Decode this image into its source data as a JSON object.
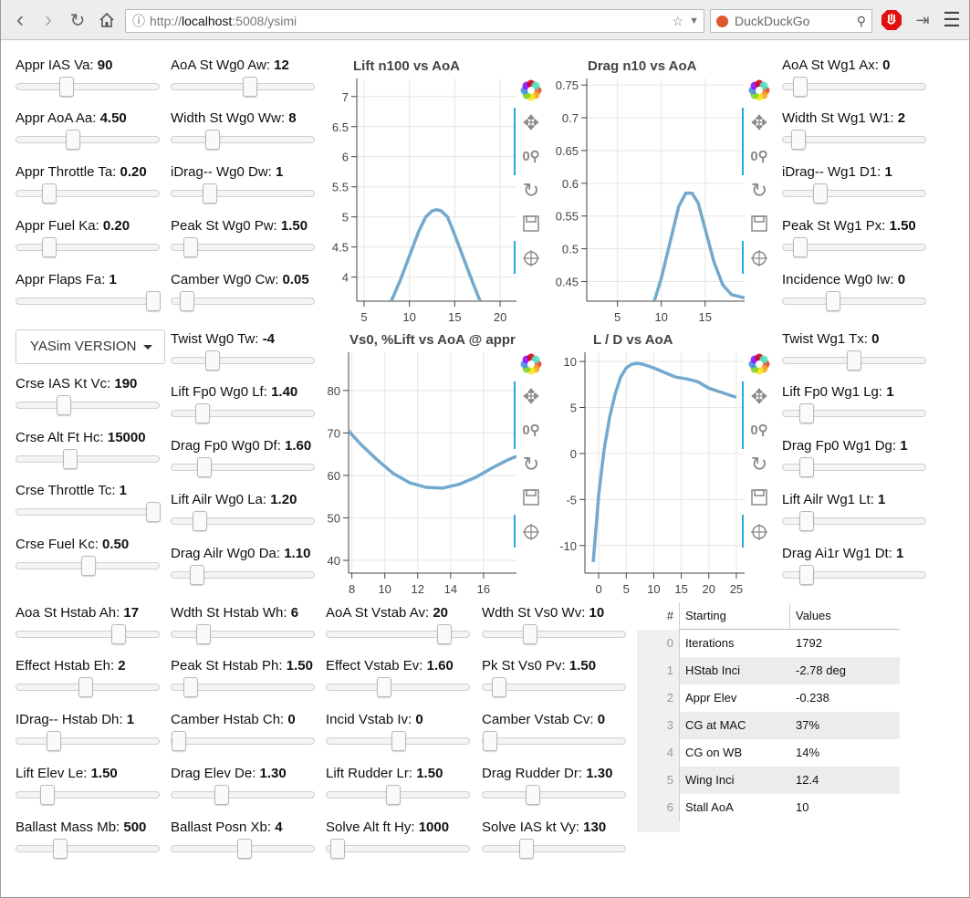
{
  "browser": {
    "url_scheme": "http://",
    "url_host": "localhost",
    "url_rest": ":5008/ysimi",
    "search_placeholder": "DuckDuckGo"
  },
  "sliders": [
    {
      "id": "appr-ias-va",
      "label": "Appr IAS Va:",
      "value": "90",
      "frac": 0.33
    },
    {
      "id": "appr-aoa-aa",
      "label": "Appr AoA Aa:",
      "value": "4.50",
      "frac": 0.38
    },
    {
      "id": "appr-throttle-ta",
      "label": "Appr Throttle Ta:",
      "value": "0.20",
      "frac": 0.2
    },
    {
      "id": "appr-fuel-ka",
      "label": "Appr Fuel Ka:",
      "value": "0.20",
      "frac": 0.2
    },
    {
      "id": "appr-flaps-fa",
      "label": "Appr Flaps Fa:",
      "value": "1",
      "frac": 1.0
    },
    {
      "id": "crse-ias-vc",
      "label": "Crse IAS Kt Vc:",
      "value": "190",
      "frac": 0.31
    },
    {
      "id": "crse-alt-hc",
      "label": "Crse Alt Ft Hc:",
      "value": "15000",
      "frac": 0.36
    },
    {
      "id": "crse-throttle-tc",
      "label": "Crse Throttle Tc:",
      "value": "1",
      "frac": 1.0
    },
    {
      "id": "crse-fuel-kc",
      "label": "Crse Fuel Kc:",
      "value": "0.50",
      "frac": 0.5
    },
    {
      "id": "aoa-st-wg0-aw",
      "label": "AoA St Wg0 Aw:",
      "value": "12",
      "frac": 0.55
    },
    {
      "id": "width-st-wg0-ww",
      "label": "Width St Wg0 Ww:",
      "value": "8",
      "frac": 0.26
    },
    {
      "id": "idrag-wg0-dw",
      "label": "iDrag-- Wg0 Dw:",
      "value": "1",
      "frac": 0.24
    },
    {
      "id": "peak-st-wg0-pw",
      "label": "Peak St Wg0 Pw:",
      "value": "1.50",
      "frac": 0.09
    },
    {
      "id": "camber-wg0-cw",
      "label": "Camber Wg0 Cw:",
      "value": "0.05",
      "frac": 0.06
    },
    {
      "id": "twist-wg0-tw",
      "label": "Twist Wg0 Tw:",
      "value": "-4",
      "frac": 0.26
    },
    {
      "id": "lift-fp0-wg0-lf",
      "label": "Lift Fp0 Wg0 Lf:",
      "value": "1.40",
      "frac": 0.18
    },
    {
      "id": "drag-fp0-wg0-df",
      "label": "Drag Fp0 Wg0 Df:",
      "value": "1.60",
      "frac": 0.2
    },
    {
      "id": "lift-ailr-wg0-la",
      "label": "Lift Ailr Wg0 La:",
      "value": "1.20",
      "frac": 0.16
    },
    {
      "id": "drag-ailr-wg0-da",
      "label": "Drag Ailr Wg0 Da:",
      "value": "1.10",
      "frac": 0.14
    },
    {
      "id": "aoa-st-wg1-ax",
      "label": "AoA St Wg1 Ax:",
      "value": "0",
      "frac": 0.08
    },
    {
      "id": "width-st-wg1-w1",
      "label": "Width St Wg1 W1:",
      "value": "2",
      "frac": 0.06
    },
    {
      "id": "idrag-wg1-d1",
      "label": "iDrag-- Wg1 D1:",
      "value": "1",
      "frac": 0.23
    },
    {
      "id": "peak-st-wg1-px",
      "label": "Peak St Wg1 Px:",
      "value": "1.50",
      "frac": 0.08
    },
    {
      "id": "incidence-wg0-iw",
      "label": "Incidence Wg0 Iw:",
      "value": "0",
      "frac": 0.33
    },
    {
      "id": "twist-wg1-tx",
      "label": "Twist Wg1 Tx:",
      "value": "0",
      "frac": 0.49
    },
    {
      "id": "lift-fp0-wg1-lg",
      "label": "Lift Fp0 Wg1 Lg:",
      "value": "1",
      "frac": 0.13
    },
    {
      "id": "drag-fp0-wg1-dg",
      "label": "Drag Fp0 Wg1 Dg:",
      "value": "1",
      "frac": 0.13
    },
    {
      "id": "lift-ailr-wg1-lt",
      "label": "Lift Ailr Wg1 Lt:",
      "value": "1",
      "frac": 0.13
    },
    {
      "id": "drag-ai1r-wg1-dt",
      "label": "Drag Ai1r Wg1 Dt:",
      "value": "1",
      "frac": 0.13
    },
    {
      "id": "aoa-st-hstab-ah",
      "label": "Aoa St Hstab Ah:",
      "value": "17",
      "frac": 0.73
    },
    {
      "id": "effect-hstab-eh",
      "label": "Effect Hstab Eh:",
      "value": "2",
      "frac": 0.48
    },
    {
      "id": "idrag-hstab-dh",
      "label": "IDrag-- Hstab Dh:",
      "value": "1",
      "frac": 0.23
    },
    {
      "id": "lift-elev-le",
      "label": "Lift Elev Le:",
      "value": "1.50",
      "frac": 0.18
    },
    {
      "id": "ballast-mass-mb",
      "label": "Ballast Mass Mb:",
      "value": "500",
      "frac": 0.28
    },
    {
      "id": "wdth-st-hstab-wh",
      "label": "Wdth St Hstab Wh:",
      "value": "6",
      "frac": 0.19
    },
    {
      "id": "peak-st-hstab-ph",
      "label": "Peak St Hstab Ph:",
      "value": "1.50",
      "frac": 0.09
    },
    {
      "id": "camber-hstab-ch",
      "label": "Camber Hstab Ch:",
      "value": "0",
      "frac": 0.0
    },
    {
      "id": "drag-elev-de",
      "label": "Drag Elev De:",
      "value": "1.30",
      "frac": 0.33
    },
    {
      "id": "ballast-posn-xb",
      "label": "Ballast Posn Xb:",
      "value": "4",
      "frac": 0.51
    },
    {
      "id": "aoa-st-vstab-av",
      "label": "AoA St Vstab Av:",
      "value": "20",
      "frac": 0.85
    },
    {
      "id": "effect-vstab-ev",
      "label": "Effect Vstab Ev:",
      "value": "1.60",
      "frac": 0.39
    },
    {
      "id": "incid-vstab-iv",
      "label": "Incid Vstab Iv:",
      "value": "0",
      "frac": 0.5
    },
    {
      "id": "lift-rudder-lr",
      "label": "Lift Rudder Lr:",
      "value": "1.50",
      "frac": 0.46
    },
    {
      "id": "solve-alt-hy",
      "label": "Solve Alt ft Hy:",
      "value": "1000",
      "frac": 0.03
    },
    {
      "id": "wdth-st-vs0-wv",
      "label": "Wdth St Vs0 Wv:",
      "value": "10",
      "frac": 0.31
    },
    {
      "id": "pk-st-vs0-pv",
      "label": "Pk St Vs0 Pv:",
      "value": "1.50",
      "frac": 0.07
    },
    {
      "id": "camber-vstab-cv",
      "label": "Camber Vstab Cv:",
      "value": "0",
      "frac": 0.0
    },
    {
      "id": "drag-rudder-dr",
      "label": "Drag Rudder Dr:",
      "value": "1.30",
      "frac": 0.33
    },
    {
      "id": "solve-ias-vy",
      "label": "Solve IAS kt Vy:",
      "value": "130",
      "frac": 0.28
    }
  ],
  "version_dropdown": {
    "label": "YASim VERSION"
  },
  "chart_data": [
    {
      "id": "lift",
      "type": "line",
      "title": "Lift n100 vs AoA",
      "xlim": [
        4.2,
        21.8
      ],
      "ylim": [
        3.6,
        7.3
      ],
      "xticks": [
        5,
        10,
        15,
        20
      ],
      "yticks": [
        4,
        4.5,
        5,
        5.5,
        6,
        6.5,
        7
      ],
      "grid": true,
      "series": [
        {
          "x": [
            8.0,
            9.0,
            10.0,
            11.0,
            11.8,
            12.5,
            13.0,
            13.5,
            14.2,
            15.0,
            16.0,
            17.0,
            17.8
          ],
          "y": [
            3.6,
            3.95,
            4.35,
            4.75,
            5.0,
            5.1,
            5.12,
            5.1,
            5.0,
            4.7,
            4.3,
            3.9,
            3.6
          ]
        }
      ]
    },
    {
      "id": "drag",
      "type": "line",
      "title": "Drag  n10 vs AoA",
      "xlim": [
        1.5,
        19.5
      ],
      "ylim": [
        0.42,
        0.76
      ],
      "xticks": [
        5,
        10,
        15
      ],
      "yticks": [
        0.45,
        0.5,
        0.55,
        0.6,
        0.65,
        0.7,
        0.75
      ],
      "grid": true,
      "series": [
        {
          "x": [
            9.2,
            10.0,
            11.0,
            12.0,
            12.8,
            13.5,
            14.2,
            15.0,
            16.0,
            17.0,
            18.0,
            19.5
          ],
          "y": [
            0.42,
            0.455,
            0.51,
            0.565,
            0.585,
            0.585,
            0.57,
            0.53,
            0.48,
            0.445,
            0.43,
            0.425
          ]
        }
      ]
    },
    {
      "id": "vs0",
      "type": "line",
      "title": "Vs0, %Lift vs AoA @ appr",
      "xlim": [
        7.8,
        18.0
      ],
      "ylim": [
        37,
        89
      ],
      "xticks": [
        8,
        10,
        12,
        14,
        16
      ],
      "yticks": [
        40,
        50,
        60,
        70,
        80
      ],
      "grid": true,
      "series": [
        {
          "x": [
            7.8,
            8.5,
            9.5,
            10.5,
            11.5,
            12.5,
            13.5,
            14.5,
            15.5,
            16.5,
            17.5,
            18.0
          ],
          "y": [
            70.5,
            67.5,
            63.8,
            60.5,
            58.3,
            57.2,
            57.0,
            57.9,
            59.5,
            61.7,
            63.7,
            64.5
          ]
        }
      ]
    },
    {
      "id": "ld",
      "type": "line",
      "title": "L / D   vs AoA",
      "xlim": [
        -2.5,
        26.5
      ],
      "ylim": [
        -13,
        11
      ],
      "xticks": [
        0,
        5,
        10,
        15,
        20,
        25
      ],
      "yticks": [
        -10,
        -5,
        0,
        5,
        10
      ],
      "grid": true,
      "series": [
        {
          "x": [
            -1,
            0,
            1,
            2,
            3,
            4,
            5,
            6,
            7,
            8,
            10,
            12,
            14,
            16,
            18,
            20,
            22,
            24,
            25
          ],
          "y": [
            -11.8,
            -4.5,
            0.5,
            4.0,
            6.5,
            8.3,
            9.3,
            9.7,
            9.8,
            9.7,
            9.3,
            8.8,
            8.3,
            8.1,
            7.8,
            7.1,
            6.7,
            6.3,
            6.1
          ]
        }
      ]
    }
  ],
  "table": {
    "headers": [
      "#",
      "Starting",
      "Values"
    ],
    "rows": [
      [
        "0",
        "Iterations",
        "1792"
      ],
      [
        "1",
        "HStab Inci",
        "-2.78 deg"
      ],
      [
        "2",
        "Appr Elev",
        "-0.238"
      ],
      [
        "3",
        "CG at MAC",
        "37%"
      ],
      [
        "4",
        "CG on WB",
        "14%"
      ],
      [
        "5",
        "Wing Inci",
        "12.4"
      ],
      [
        "6",
        "Stall AoA",
        "10"
      ]
    ]
  }
}
